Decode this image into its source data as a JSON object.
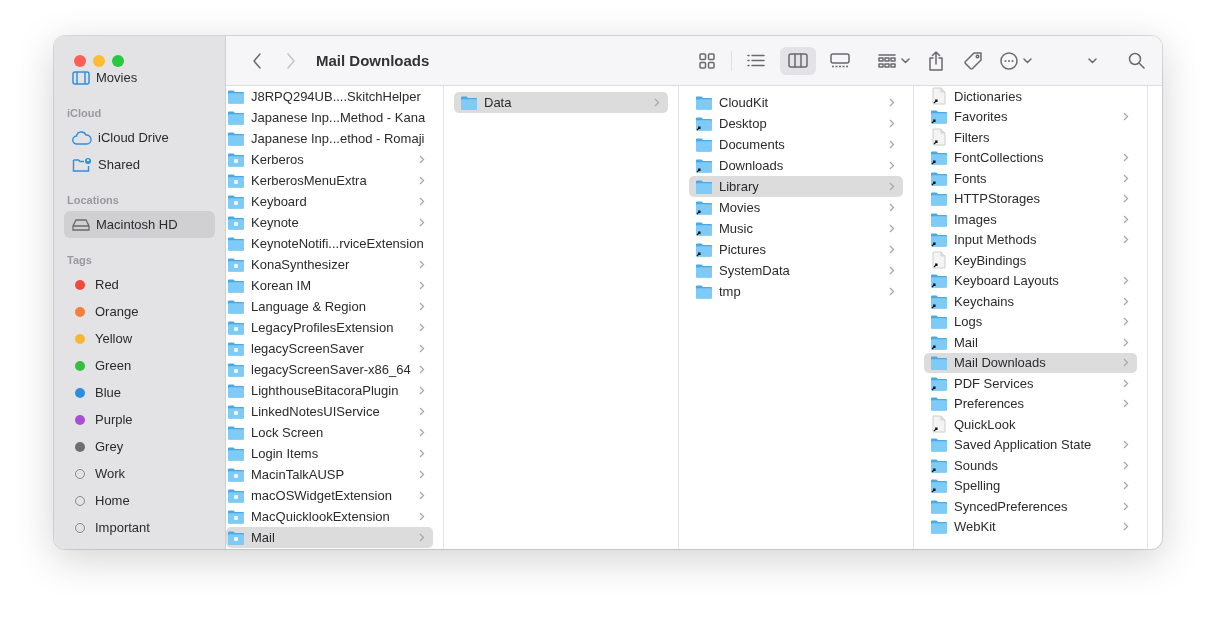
{
  "sidebar": {
    "sections": [
      {
        "items": [
          {
            "label": "Movies",
            "kind": "film",
            "selected": false
          }
        ]
      },
      {
        "header": "iCloud",
        "items": [
          {
            "label": "iCloud Drive",
            "kind": "cloud",
            "selected": false
          },
          {
            "label": "Shared",
            "kind": "shared",
            "selected": false
          }
        ]
      },
      {
        "header": "Locations",
        "items": [
          {
            "label": "Macintosh HD",
            "kind": "drive",
            "selected": true
          }
        ]
      },
      {
        "header": "Tags",
        "items": [
          {
            "label": "Red",
            "kind": "tag",
            "color": "#f2493d",
            "selected": false
          },
          {
            "label": "Orange",
            "kind": "tag",
            "color": "#f5803a",
            "selected": false
          },
          {
            "label": "Yellow",
            "kind": "tag",
            "color": "#f7b731",
            "selected": false
          },
          {
            "label": "Green",
            "kind": "tag",
            "color": "#35c042",
            "selected": false
          },
          {
            "label": "Blue",
            "kind": "tag",
            "color": "#2d8ee0",
            "selected": false
          },
          {
            "label": "Purple",
            "kind": "tag",
            "color": "#a94fd6",
            "selected": false
          },
          {
            "label": "Grey",
            "kind": "tag",
            "color": "#6f6f72",
            "selected": false
          },
          {
            "label": "Work",
            "kind": "tag",
            "selected": false
          },
          {
            "label": "Home",
            "kind": "tag",
            "selected": false
          },
          {
            "label": "Important",
            "kind": "tag",
            "selected": false
          }
        ]
      }
    ]
  },
  "toolbar": {
    "back": {
      "disabled": false
    },
    "forward": {
      "disabled": true
    },
    "title": "Mail Downloads",
    "views": [
      {
        "kind": "icons",
        "selected": false
      },
      {
        "kind": "list",
        "selected": false
      },
      {
        "kind": "columns",
        "selected": true
      },
      {
        "kind": "gallery",
        "selected": false
      }
    ]
  },
  "columns": [
    {
      "items": [
        {
          "name": "J8RPQ294UB....SkitchHelper",
          "kind": "folder",
          "selected": false
        },
        {
          "name": "Japanese Inp...Method - Kana",
          "kind": "folder",
          "selected": false
        },
        {
          "name": "Japanese Inp...ethod - Romaji",
          "kind": "folder",
          "selected": false
        },
        {
          "name": "Kerberos",
          "kind": "app-folder",
          "selected": false
        },
        {
          "name": "KerberosMenuExtra",
          "kind": "app-folder",
          "selected": false
        },
        {
          "name": "Keyboard",
          "kind": "app-folder",
          "selected": false
        },
        {
          "name": "Keynote",
          "kind": "app-folder",
          "selected": false
        },
        {
          "name": "KeynoteNotifi...rviceExtension",
          "kind": "folder",
          "selected": false
        },
        {
          "name": "KonaSynthesizer",
          "kind": "app-folder",
          "selected": false
        },
        {
          "name": "Korean IM",
          "kind": "folder",
          "selected": false
        },
        {
          "name": "Language & Region",
          "kind": "folder",
          "selected": false
        },
        {
          "name": "LegacyProfilesExtension",
          "kind": "app-folder",
          "selected": false
        },
        {
          "name": "legacyScreenSaver",
          "kind": "app-folder",
          "selected": false
        },
        {
          "name": "legacyScreenSaver-x86_64",
          "kind": "app-folder",
          "selected": false
        },
        {
          "name": "LighthouseBitacoraPlugin",
          "kind": "folder",
          "selected": false
        },
        {
          "name": "LinkedNotesUIService",
          "kind": "app-folder",
          "selected": false
        },
        {
          "name": "Lock Screen",
          "kind": "folder",
          "selected": false
        },
        {
          "name": "Login Items",
          "kind": "folder",
          "selected": false
        },
        {
          "name": "MacinTalkAUSP",
          "kind": "app-folder",
          "selected": false
        },
        {
          "name": "macOSWidgetExtension",
          "kind": "app-folder",
          "selected": false
        },
        {
          "name": "MacQuicklookExtension",
          "kind": "app-folder",
          "selected": false
        },
        {
          "name": "Mail",
          "kind": "app-folder",
          "selected": true
        }
      ]
    },
    {
      "items": [
        {
          "name": "Data",
          "kind": "folder",
          "selected": true
        }
      ]
    },
    {
      "items": [
        {
          "name": "CloudKit",
          "kind": "folder",
          "selected": false
        },
        {
          "name": "Desktop",
          "kind": "alias",
          "selected": false
        },
        {
          "name": "Documents",
          "kind": "folder",
          "selected": false
        },
        {
          "name": "Downloads",
          "kind": "alias",
          "selected": false
        },
        {
          "name": "Library",
          "kind": "folder",
          "selected": true
        },
        {
          "name": "Movies",
          "kind": "alias",
          "selected": false
        },
        {
          "name": "Music",
          "kind": "alias",
          "selected": false
        },
        {
          "name": "Pictures",
          "kind": "alias",
          "selected": false
        },
        {
          "name": "SystemData",
          "kind": "folder",
          "selected": false
        },
        {
          "name": "tmp",
          "kind": "folder",
          "selected": false
        }
      ]
    },
    {
      "items": [
        {
          "name": "Dictionaries",
          "kind": "file",
          "selected": false
        },
        {
          "name": "Favorites",
          "kind": "alias",
          "selected": false
        },
        {
          "name": "Filters",
          "kind": "file",
          "selected": false
        },
        {
          "name": "FontCollections",
          "kind": "alias",
          "selected": false
        },
        {
          "name": "Fonts",
          "kind": "alias",
          "selected": false
        },
        {
          "name": "HTTPStorages",
          "kind": "folder",
          "selected": false
        },
        {
          "name": "Images",
          "kind": "folder",
          "selected": false
        },
        {
          "name": "Input Methods",
          "kind": "alias",
          "selected": false
        },
        {
          "name": "KeyBindings",
          "kind": "file",
          "selected": false
        },
        {
          "name": "Keyboard Layouts",
          "kind": "alias",
          "selected": false
        },
        {
          "name": "Keychains",
          "kind": "alias",
          "selected": false
        },
        {
          "name": "Logs",
          "kind": "folder",
          "selected": false
        },
        {
          "name": "Mail",
          "kind": "alias",
          "selected": false
        },
        {
          "name": "Mail Downloads",
          "kind": "folder",
          "selected": true
        },
        {
          "name": "PDF Services",
          "kind": "alias",
          "selected": false
        },
        {
          "name": "Preferences",
          "kind": "folder",
          "selected": false
        },
        {
          "name": "QuickLook",
          "kind": "file",
          "selected": false
        },
        {
          "name": "Saved Application State",
          "kind": "folder",
          "selected": false
        },
        {
          "name": "Sounds",
          "kind": "alias",
          "selected": false
        },
        {
          "name": "Spelling",
          "kind": "alias",
          "selected": false
        },
        {
          "name": "SyncedPreferences",
          "kind": "folder",
          "selected": false
        },
        {
          "name": "WebKit",
          "kind": "folder",
          "selected": false
        }
      ]
    }
  ]
}
